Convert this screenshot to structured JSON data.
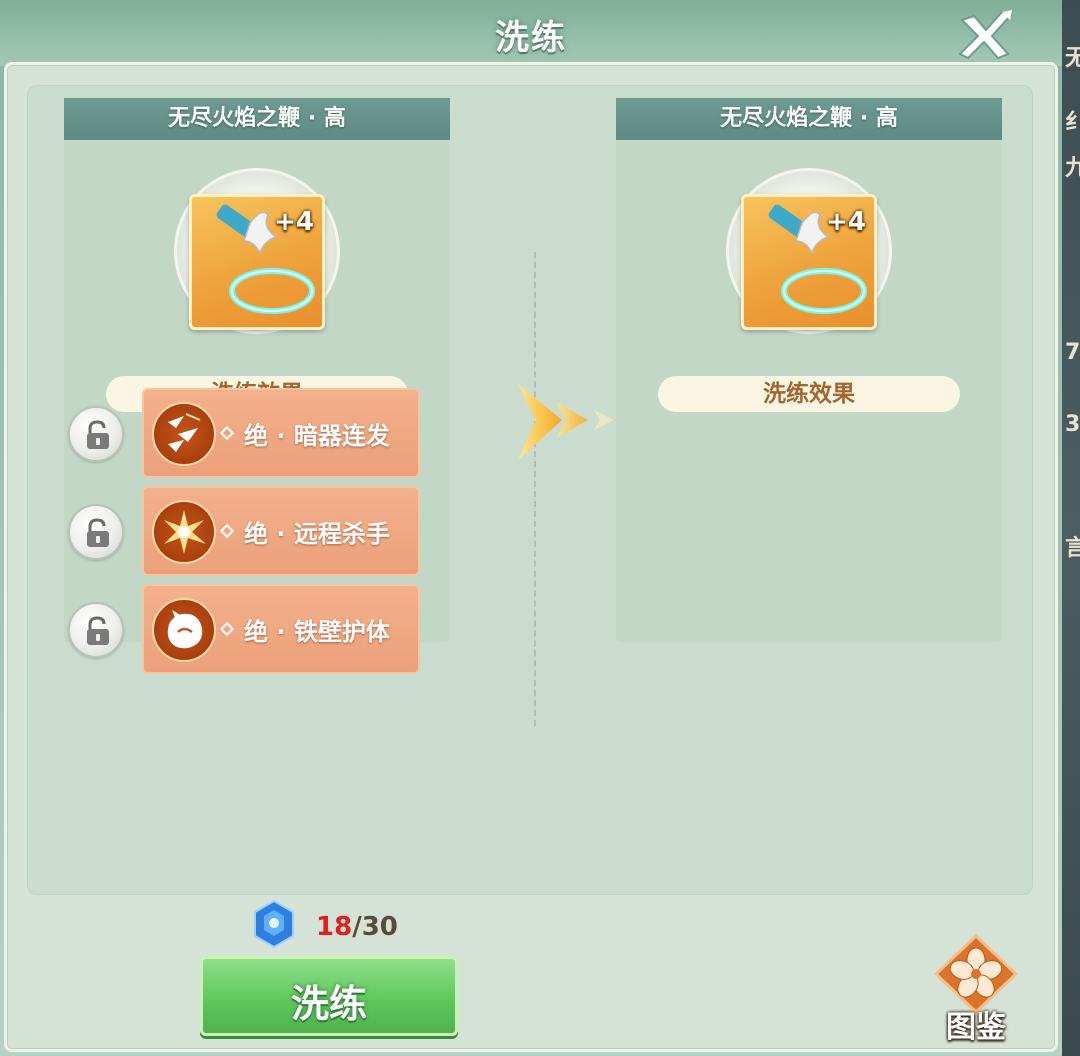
{
  "window": {
    "title": "洗练"
  },
  "background_edge_chars": [
    "无",
    "纟",
    "九",
    "7",
    "3",
    "言"
  ],
  "left_item": {
    "name": "无尽火焰之鞭 · 高",
    "level": "+4",
    "effect_header": "洗练效果"
  },
  "right_item": {
    "name": "无尽火焰之鞭 · 高",
    "level": "+4",
    "effect_header": "洗练效果"
  },
  "effects": [
    {
      "icon": "darts-icon",
      "text": "绝 · 暗器连发",
      "locked": false
    },
    {
      "icon": "burst-icon",
      "text": "绝 · 远程杀手",
      "locked": false
    },
    {
      "icon": "shield-creature-icon",
      "text": "绝 · 铁壁护体",
      "locked": false
    }
  ],
  "cost": {
    "current": "18",
    "separator": "/",
    "total": "30",
    "icon": "gem-icon"
  },
  "refine_button": {
    "label": "洗练"
  },
  "codex_button": {
    "label": "图鉴",
    "icon": "flower-icon"
  },
  "colors": {
    "accent_green": "#5fc75e",
    "title_bar": "#5d8b82",
    "effect_card": "#eca07a",
    "cost_current": "#e0201c"
  }
}
